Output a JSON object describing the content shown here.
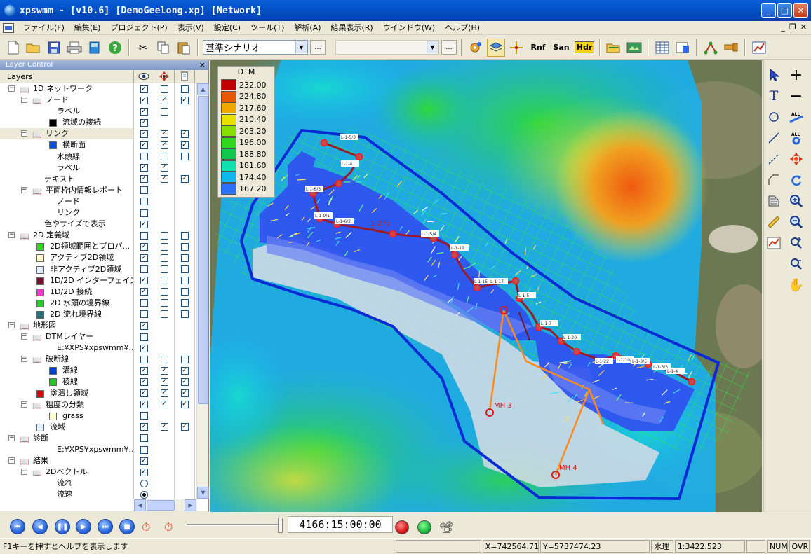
{
  "window": {
    "title": "xpswmm - [v10.6] [DemoGeelong.xp] [Network]"
  },
  "menu": [
    "ファイル(F)",
    "編集(E)",
    "プロジェクト(P)",
    "表示(V)",
    "設定(C)",
    "ツール(T)",
    "解析(A)",
    "結果表示(R)",
    "ウインドウ(W)",
    "ヘルプ(H)"
  ],
  "toolbar": {
    "scenario_value": "基準シナリオ",
    "ellipsis_label": "...",
    "rnf_label": "Rnf",
    "san_label": "San",
    "hdr_label": "Hdr"
  },
  "layer_panel": {
    "title": "Layer Control",
    "close_label": "×",
    "header_label": "Layers",
    "rows": [
      {
        "label": "1D ネットワーク",
        "c1": true,
        "c2": false,
        "c3": false
      },
      {
        "label": "ノード",
        "c1": true,
        "c2": true,
        "c3": true
      },
      {
        "label": "ラベル",
        "c1": true,
        "c2": false,
        "c3": null
      },
      {
        "label": "流域の接続",
        "c1": true,
        "c2": null,
        "c3": null,
        "swatch": "#000000"
      },
      {
        "label": "リンク",
        "c1": true,
        "c2": true,
        "c3": true
      },
      {
        "label": "横断面",
        "c1": true,
        "c2": true,
        "c3": true,
        "swatch": "#0050e8"
      },
      {
        "label": "水頭線",
        "c1": false,
        "c2": false,
        "c3": false
      },
      {
        "label": "ラベル",
        "c1": true,
        "c2": true,
        "c3": null
      },
      {
        "label": "テキスト",
        "c1": true,
        "c2": true,
        "c3": true
      },
      {
        "label": "平面枠内情報レポート",
        "c1": false,
        "c2": null,
        "c3": null
      },
      {
        "label": "ノード",
        "c1": false,
        "c2": null,
        "c3": null
      },
      {
        "label": "リンク",
        "c1": false,
        "c2": null,
        "c3": null
      },
      {
        "label": "色やサイズで表示",
        "c1": true,
        "c2": null,
        "c3": null
      },
      {
        "label": "2D 定義域",
        "c1": false,
        "c2": false,
        "c3": false
      },
      {
        "label": "2D領域範囲とプロパ...",
        "c1": true,
        "c2": false,
        "c3": false,
        "swatch": "#22dd22"
      },
      {
        "label": "アクティブ2D領域",
        "c1": true,
        "c2": false,
        "c3": false,
        "swatch": "#fff6cc"
      },
      {
        "label": "非アクティブ2D領域",
        "c1": false,
        "c2": false,
        "c3": false,
        "swatch": "#dceeff"
      },
      {
        "label": "1D/2D インターフェイス",
        "c1": true,
        "c2": false,
        "c3": false,
        "swatch": "#7a1030"
      },
      {
        "label": "1D/2D 接続",
        "c1": true,
        "c2": false,
        "c3": false,
        "swatch": "#ff33cc"
      },
      {
        "label": "2D 水頭の境界線",
        "c1": false,
        "c2": false,
        "c3": false,
        "swatch": "#22cc22"
      },
      {
        "label": "2D 流れ境界線",
        "c1": false,
        "c2": false,
        "c3": false,
        "swatch": "#2a6f7a"
      },
      {
        "label": "地形図",
        "c1": true,
        "c2": null,
        "c3": null
      },
      {
        "label": "DTMレイヤー",
        "c1": false,
        "c2": null,
        "c3": null
      },
      {
        "label": "E:¥XPS¥xpswmm¥...",
        "c1": true,
        "c2": null,
        "c3": null
      },
      {
        "label": "破断線",
        "c1": false,
        "c2": false,
        "c3": false
      },
      {
        "label": "溝線",
        "c1": true,
        "c2": true,
        "c3": true,
        "swatch": "#0040e0"
      },
      {
        "label": "稜線",
        "c1": true,
        "c2": true,
        "c3": true,
        "swatch": "#22cc22"
      },
      {
        "label": "塗潰し領域",
        "c1": true,
        "c2": true,
        "c3": true,
        "swatch": "#e00000"
      },
      {
        "label": "粗度の分類",
        "c1": true,
        "c2": true,
        "c3": true
      },
      {
        "label": "grass",
        "c1": false,
        "c2": null,
        "c3": null,
        "swatch": "#ffffcc"
      },
      {
        "label": "流域",
        "c1": true,
        "c2": true,
        "c3": true,
        "swatch": "#dceeff"
      },
      {
        "label": "診断",
        "c1": false,
        "c2": null,
        "c3": null
      },
      {
        "label": "E:¥XPS¥xpswmm¥...",
        "c1": false,
        "c2": null,
        "c3": null
      },
      {
        "label": "結果",
        "c1": true,
        "c2": null,
        "c3": null
      },
      {
        "label": "2Dベクトル",
        "c1": true,
        "c2": null,
        "c3": null
      },
      {
        "label": "流れ",
        "c1": "radio-off",
        "c2": null,
        "c3": null
      },
      {
        "label": "流速",
        "c1": "radio-on",
        "c2": null,
        "c3": null
      }
    ]
  },
  "dtm_legend": {
    "title": "DTM",
    "entries": [
      {
        "value": "232.00",
        "color": "#c00000"
      },
      {
        "value": "224.80",
        "color": "#e85a00"
      },
      {
        "value": "217.60",
        "color": "#f0a800"
      },
      {
        "value": "210.40",
        "color": "#e8e000"
      },
      {
        "value": "203.20",
        "color": "#88e000"
      },
      {
        "value": "196.00",
        "color": "#30d820"
      },
      {
        "value": "188.80",
        "color": "#10c850"
      },
      {
        "value": "181.60",
        "color": "#10e0b0"
      },
      {
        "value": "174.40",
        "color": "#10b8f0"
      },
      {
        "value": "167.20",
        "color": "#2a70f8"
      }
    ]
  },
  "map_labels": {
    "link_271": "1-271",
    "mh3": "MH 3",
    "mh4": "MH 4",
    "small_labels": [
      "L-1-5/3",
      "L-1-4",
      "L-1-6/3",
      "L-1-9/1",
      "L-1-6/2",
      "L-1-5/4",
      "L-1-12",
      "L-1-15",
      "L-1-17",
      "L-1-5",
      "L-1-7",
      "L-1-20",
      "L-1-22",
      "L-1-10/1",
      "L-1-3/5",
      "L-1-3/3",
      "L-1-4"
    ]
  },
  "playback": {
    "time": "4166:15:00:00"
  },
  "status": {
    "help": "F1キーを押すとヘルプを表示します",
    "x": "X=742564.71",
    "y": "Y=5737474.23",
    "mode": "水理",
    "scale": "1:3422.523",
    "num": "NUM",
    "ovr": "OVR"
  },
  "colors": {
    "boundary": "#0a2ad6",
    "link": "#9a1c2a",
    "node_outline": "#ff1a1a",
    "pipe": "#ff8a1c",
    "grid": "#2ee84a"
  }
}
